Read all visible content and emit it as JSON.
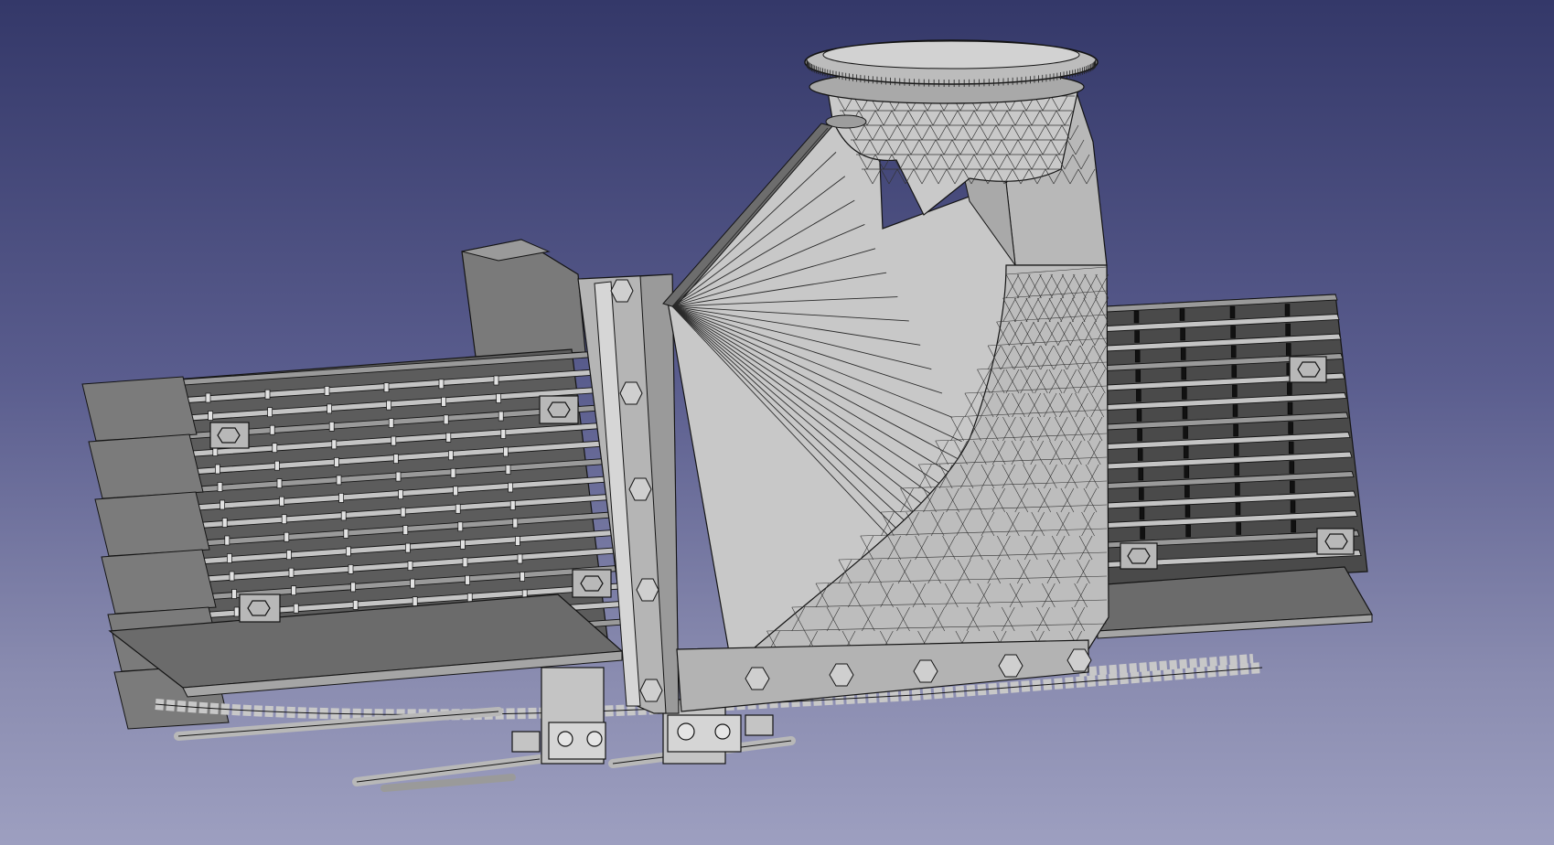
{
  "viewport": {
    "background_top": "#343869",
    "background_bottom": "#9d9fc0"
  },
  "model": {
    "fill": "#c4c4c4",
    "fill_shade": "#8d8d8d",
    "fill_dark": "#5f5f5f",
    "edge": "#141414"
  }
}
